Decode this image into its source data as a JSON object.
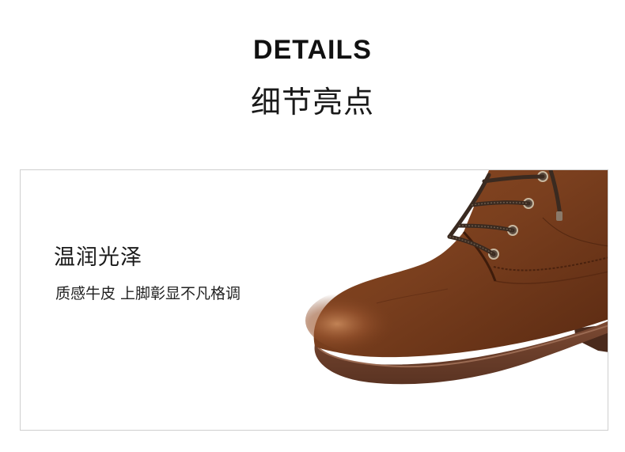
{
  "header": {
    "title_en": "DETAILS",
    "title_cn": "细节亮点"
  },
  "feature": {
    "title": "温润光泽",
    "description": "质感牛皮 上脚彰显不凡格调"
  },
  "image": {
    "subject": "brown-leather-lace-up-boot",
    "colors": {
      "leather": "#7a3f1e",
      "leather_highlight": "#b8734a",
      "sole": "#6b3e2a",
      "border": "#cfcfcf"
    }
  }
}
